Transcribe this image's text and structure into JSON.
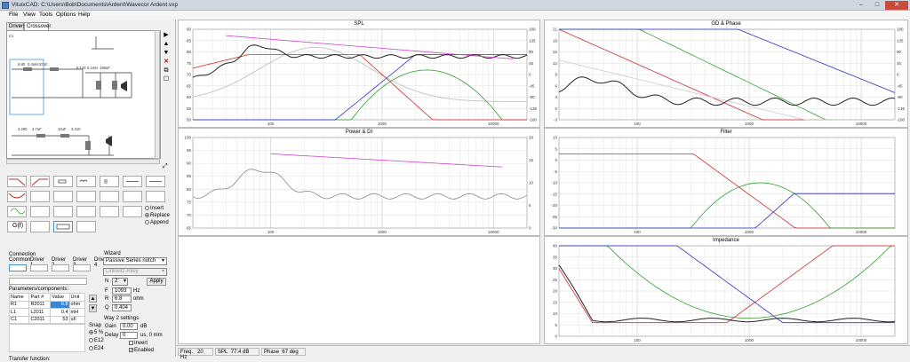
{
  "window": {
    "title": "VituixCAD: C:\\Users\\Bob\\Documents\\Ardent\\Wavecor Ardent.vxp",
    "min": "–",
    "max": "□",
    "close": "✕"
  },
  "menu": [
    "File",
    "View",
    "Tools",
    "Options",
    "Help"
  ],
  "tabs": [
    "Drivers",
    "Crossover"
  ],
  "schematic": {
    "labels": [
      "C1",
      "L1",
      "R2",
      "C2",
      "R1",
      "L2",
      "R3",
      "L3",
      "R4",
      "C3",
      "R5",
      "C4",
      "R6"
    ],
    "values": [
      "6.80",
      "0.4mH",
      "57uF",
      "6.120",
      "0.1mH",
      "188uF",
      "3.290",
      "4.7uF",
      "10uF",
      "3.310",
      "6.5",
      "2.7",
      "4.3",
      "0.22mH",
      "0.5",
      "0.5"
    ]
  },
  "palette_icons": [
    "lowpass-icon",
    "highpass-icon",
    "resistor-icon",
    "inductor-icon",
    "capacitor-icon",
    "series-rlc-icon",
    "bandpass-icon",
    "notch-icon",
    "parallel-r-icon",
    "parallel-l-icon",
    "parallel-c-icon",
    "parallel-rlc-icon",
    "allpass-icon",
    "peak-icon",
    "split-icon",
    "transformer-icon",
    "lpad-icon",
    "zobel-icon",
    "eq-icon",
    "gf-icon",
    "tank-icon",
    "network-icon",
    "inverter-icon",
    "gain-icon"
  ],
  "gf_label": "G(f)",
  "insert_mode": {
    "options": [
      "Insert",
      "Replace",
      "Append"
    ],
    "selected": 1
  },
  "connection": {
    "title": "Connection",
    "tabs": [
      "Common",
      "Driver 1",
      "Driver 2",
      "Driver 3",
      "Driver 4"
    ]
  },
  "wizard": {
    "title": "Wizard",
    "type": "Passive Series notch",
    "align": "Linkwitz-Riley",
    "n_label": "N",
    "n_value": "2",
    "apply": "Apply",
    "f_label": "F",
    "f_value": "1093",
    "f_unit": "Hz",
    "r_label": "R",
    "r_value": "6.8",
    "r_unit": "ohm",
    "q_label": "Q",
    "q_value": "0.404"
  },
  "way2": {
    "title": "Way 2 settings",
    "gain_label": "Gain",
    "gain_value": "0.00",
    "gain_unit": "dB",
    "delay_label": "Delay",
    "delay_value": "0",
    "delay_unit": "us, 0 mm",
    "invert": "Invert",
    "enabled": "Enabled"
  },
  "snap": {
    "title": "Snap",
    "options": [
      "5 %",
      "E12",
      "E24"
    ],
    "selected": 0
  },
  "params": {
    "title": "Parameters/components:",
    "headers": [
      "Name",
      "Part #",
      "Value",
      "Unit"
    ],
    "rows": [
      [
        "R1",
        "R2011",
        "6.8",
        "ohm"
      ],
      [
        "L1",
        "L2011",
        "0.4",
        "mH"
      ],
      [
        "C1",
        "C2011",
        "53",
        "uF"
      ]
    ]
  },
  "transfer_label": "Transfer function:",
  "plots": {
    "spl": {
      "title": "SPL",
      "y_left": [
        "90",
        "85",
        "80",
        "75",
        "70",
        "65",
        "60",
        "55",
        "50"
      ],
      "y_right": [
        "180",
        "135",
        "90",
        "45",
        "0",
        "-45",
        "-90",
        "-135",
        "-180"
      ],
      "x": [
        "100",
        "1000",
        "10000"
      ]
    },
    "gd": {
      "title": "GD & Phase",
      "y_left": [
        "21",
        "18",
        "15",
        "12",
        "9",
        "6",
        "3",
        "0",
        "-3"
      ],
      "y_right": [
        "180",
        "135",
        "90",
        "45",
        "0",
        "-45",
        "-90",
        "-135",
        "-180"
      ],
      "x": [
        "100",
        "1000",
        "10000"
      ]
    },
    "power": {
      "title": "Power & DI",
      "y_left": [
        "100",
        "95",
        "90",
        "85",
        "80",
        "75",
        "70",
        "65"
      ],
      "y_right": [
        "20",
        "15",
        "10",
        "5",
        "0"
      ],
      "x": [
        "100",
        "1000",
        "10000"
      ]
    },
    "filter": {
      "title": "Filter",
      "y_left": [
        "10",
        "5",
        "0",
        "-5",
        "-10",
        "-15",
        "-20",
        "-25",
        "-30"
      ],
      "x": [
        "100",
        "1000",
        "10000"
      ]
    },
    "impedance": {
      "title": "Impedance",
      "y_left": [
        "40",
        "35",
        "30",
        "25",
        "20",
        "15",
        "10",
        "5",
        "0"
      ],
      "x": [
        "100",
        "1000",
        "10000"
      ]
    }
  },
  "status": {
    "freq_label": "Freq.",
    "freq_value": "20 Hz",
    "spl_label": "SPL",
    "spl_value": "77.4 dB",
    "phase_label": "Phase",
    "phase_value": "67 deg"
  },
  "colors": {
    "black": "#222222",
    "red": "#d03030",
    "green": "#30a030",
    "blue": "#3030c8",
    "magenta": "#d040d0",
    "grey": "#9a9a9a"
  }
}
